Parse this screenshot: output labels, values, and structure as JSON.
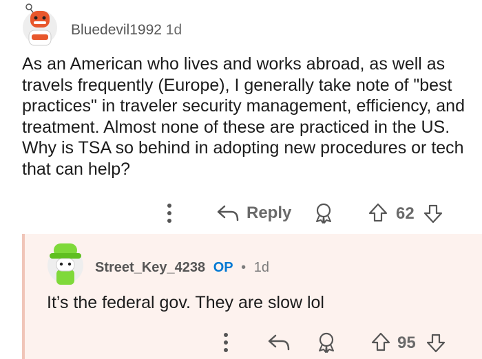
{
  "comment": {
    "username": "Bluedevil1992",
    "age": "1d",
    "text": "As an American who lives and works abroad, as well as travels frequently (Europe), I generally take note of \"best practices\" in traveler security management, efficiency, and treatment. Almost none of these are practiced in the US. Why is TSA so behind in adopting new procedures or tech that can help?",
    "actions": {
      "reply_label": "Reply",
      "vote_count": "62"
    }
  },
  "reply": {
    "username": "Street_Key_4238",
    "op_badge": "OP",
    "separator": "•",
    "age": "1d",
    "text": "It’s the federal gov. They are slow lol",
    "actions": {
      "vote_count": "95"
    }
  },
  "colors": {
    "reply_bg": "#fdf2ee",
    "thread_line": "#f0c5b8",
    "op_badge": "#0079d3",
    "meta_text": "#6a6a6a"
  },
  "icons": [
    "more-options-icon",
    "reply-arrow-icon",
    "award-icon",
    "upvote-icon",
    "downvote-icon"
  ]
}
